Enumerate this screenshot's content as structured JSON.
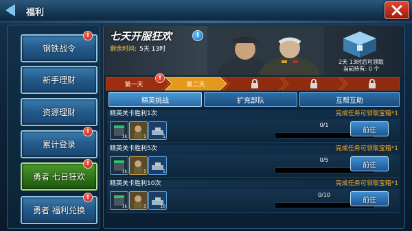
{
  "window": {
    "title": "福利"
  },
  "sidebar": {
    "items": [
      {
        "label": "钢铁战令",
        "badge": "!"
      },
      {
        "label": "新手理财",
        "badge": ""
      },
      {
        "label": "资源理财",
        "badge": ""
      },
      {
        "label": "累计登录",
        "badge": "!"
      },
      {
        "label": "勇者 七日狂欢",
        "badge": "!",
        "active": true
      },
      {
        "label": "勇者 福利兑换",
        "badge": "!"
      }
    ]
  },
  "event": {
    "title": "七天开服狂欢",
    "info_icon": "!",
    "time_label": "剩余时间:",
    "time_value": "5天 13时",
    "chest_unlock": "2天 13时后可领取",
    "chest_owned": "当前持有: 0 个"
  },
  "days": [
    {
      "label": "第一天",
      "badge": "!",
      "locked": false
    },
    {
      "label": "第二天",
      "badge": "",
      "locked": false,
      "active": true
    },
    {
      "label": "",
      "locked": true
    },
    {
      "label": "",
      "locked": true
    },
    {
      "label": "",
      "locked": true
    }
  ],
  "subtabs": [
    {
      "label": "精英挑战",
      "active": true
    },
    {
      "label": "扩充部队"
    },
    {
      "label": "互帮互助"
    }
  ],
  "tasks": [
    {
      "name": "精英关卡胜利1次",
      "reward_text": "完成任务可领取宝箱*1",
      "progress_text": "0/1",
      "progress": 0.0,
      "button": "前往",
      "items": [
        {
          "icon": "crate-icon",
          "count": "1k"
        },
        {
          "icon": "soldier-icon",
          "count": "5"
        },
        {
          "icon": "tank-icon",
          "count": "5"
        }
      ]
    },
    {
      "name": "精英关卡胜利5次",
      "reward_text": "完成任务可领取宝箱*1",
      "progress_text": "0/5",
      "progress": 0.0,
      "button": "前往",
      "items": [
        {
          "icon": "crate-icon",
          "count": "1k"
        },
        {
          "icon": "soldier-icon",
          "count": "5"
        },
        {
          "icon": "tank-icon",
          "count": "5"
        }
      ]
    },
    {
      "name": "精英关卡胜利10次",
      "reward_text": "完成任务可领取宝箱*1",
      "progress_text": "0/10",
      "progress": 0.0,
      "button": "前往",
      "items": [
        {
          "icon": "crate-icon",
          "count": "1k"
        },
        {
          "icon": "soldier-icon",
          "count": "5"
        },
        {
          "icon": "tank-icon",
          "count": "10"
        }
      ]
    }
  ],
  "colors": {
    "accent_blue": "#3f8fd2",
    "active_green": "#2f7418",
    "day_active": "#e39a1c",
    "reward_orange": "#ffb020",
    "time_label": "#ffc940"
  }
}
